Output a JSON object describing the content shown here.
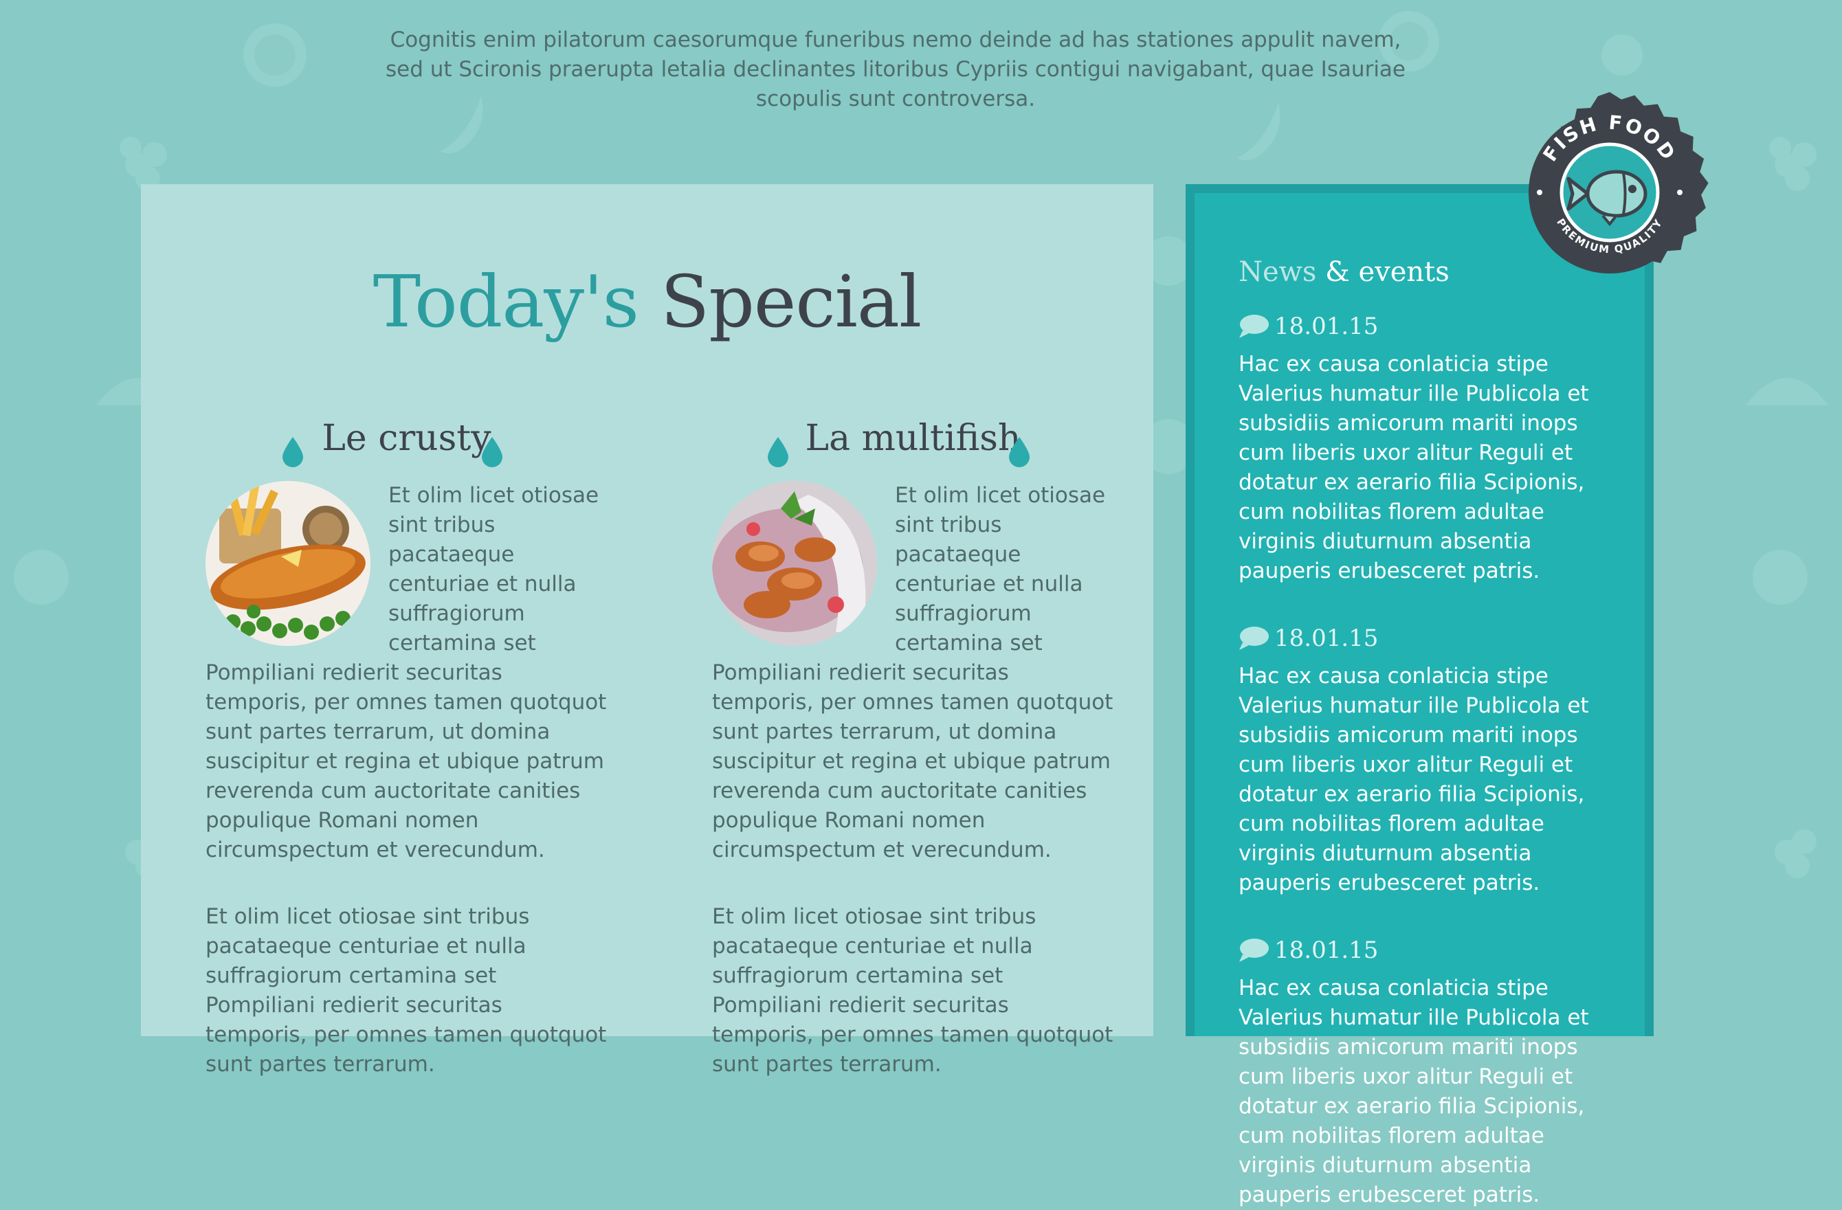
{
  "intro": {
    "text": "Cognitis enim pilatorum caesorumque funeribus nemo deinde ad has stationes appulit navem, sed ut Scironis praerupta letalia declinantes litoribus Cypriis contigui navigabant, quae Isauriae scopulis sunt controversa."
  },
  "main": {
    "title_accent": "Today's",
    "title_rest": " Special",
    "dishes": [
      {
        "name": "Le crusty",
        "image_icon": "fish-and-chips-photo",
        "paragraph1": "Et olim licet otiosae sint tribus pacataeque centuriae et nulla suffragiorum certamina set Pompiliani redierit securitas temporis, per omnes tamen quotquot sunt partes terrarum, ut domina suscipitur et regina et ubique patrum reverenda cum auctoritate canities populique Romani nomen circumspectum et verecundum.",
        "paragraph2": "Et olim licet otiosae sint tribus pacataeque centuriae et nulla suffragiorum certamina set Pompiliani redierit securitas temporis, per omnes tamen quotquot sunt partes terrarum."
      },
      {
        "name": "La multifish",
        "image_icon": "fried-fish-wrap-photo",
        "paragraph1": "Et olim licet otiosae sint tribus pacataeque centuriae et nulla suffragiorum certamina set Pompiliani redierit securitas temporis, per omnes tamen quotquot sunt partes terrarum, ut domina suscipitur et regina et ubique patrum reverenda cum auctoritate canities populique Romani nomen circumspectum et verecundum.",
        "paragraph2": "Et olim licet otiosae sint tribus pacataeque centuriae et nulla suffragiorum certamina set Pompiliani redierit securitas temporis, per omnes tamen quotquot sunt partes terrarum."
      }
    ]
  },
  "sidebar": {
    "title_muted": "News",
    "title_strong": " & events",
    "items": [
      {
        "date": "18.01.15",
        "text": "Hac ex causa conlaticia stipe Valerius humatur ille Publicola et subsidiis amicorum mariti inops cum liberis uxor alitur Reguli et dotatur ex aerario filia Scipionis, cum nobilitas florem adultae virginis diuturnum absentia pauperis erubesceret patris."
      },
      {
        "date": "18.01.15",
        "text": "Hac ex causa conlaticia stipe Valerius humatur ille Publicola et subsidiis amicorum mariti inops cum liberis uxor alitur Reguli et dotatur ex aerario filia Scipionis, cum nobilitas florem adultae virginis diuturnum absentia pauperis erubesceret patris."
      },
      {
        "date": "18.01.15",
        "text": "Hac ex causa conlaticia stipe Valerius humatur ille Publicola et subsidiis amicorum mariti inops cum liberis uxor alitur Reguli et dotatur ex aerario filia Scipionis, cum nobilitas florem adultae virginis diuturnum absentia pauperis erubesceret patris."
      }
    ]
  },
  "badge": {
    "top_text": "FISH FOOD",
    "bottom_text": "PREMIUM QUALITY",
    "icon": "fish-icon"
  },
  "colors": {
    "page_bg": "#88cac5",
    "panel_bg": "#b4dedc",
    "accent": "#2c9ea0",
    "sidebar_bg": "#22b2b2",
    "dark": "#3e434b"
  }
}
